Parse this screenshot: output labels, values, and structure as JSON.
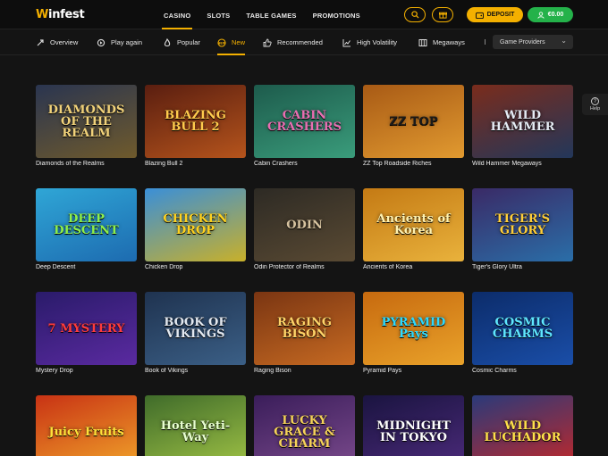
{
  "logo": {
    "text": "infest",
    "accent": "W"
  },
  "nav": {
    "items": [
      "CASINO",
      "SLOTS",
      "TABLE GAMES",
      "PROMOTIONS"
    ],
    "active": "CASINO"
  },
  "header": {
    "deposit_label": "DEPOSIT",
    "balance": "€0.00"
  },
  "categories": [
    "Overview",
    "Play again",
    "Popular",
    "New",
    "Recommended",
    "High Volatility",
    "Megaways"
  ],
  "providers": {
    "label": "Game Providers"
  },
  "help": {
    "label": "Help"
  },
  "games": [
    {
      "title": "Diamonds of the Realms",
      "art": "DIAMONDS OF THE REALM",
      "c1": "#2a3550",
      "c2": "#6f5a2c",
      "fg": "#f1d27a"
    },
    {
      "title": "Blazing Bull 2",
      "art": "BLAZING BULL 2",
      "c1": "#5a1e10",
      "c2": "#b5541c",
      "fg": "#ffcb4d"
    },
    {
      "title": "Cabin Crashers",
      "art": "CABIN CRASHERS",
      "c1": "#1d5b4c",
      "c2": "#3a9c7b",
      "fg": "#e86fb2"
    },
    {
      "title": "ZZ Top Roadside Riches",
      "art": "ZZ TOP",
      "c1": "#a85a15",
      "c2": "#e19a30",
      "fg": "#1b1b1b"
    },
    {
      "title": "Wild Hammer Megaways",
      "art": "WILD HAMMER",
      "c1": "#7a2c1c",
      "c2": "#23375a",
      "fg": "#e6ecf5"
    },
    {
      "title": "Deep Descent",
      "art": "DEEP DESCENT",
      "c1": "#2fa6d6",
      "c2": "#1d6bb0",
      "fg": "#8ff04a"
    },
    {
      "title": "Chicken Drop",
      "art": "CHICKEN DROP",
      "c1": "#3a8fd8",
      "c2": "#c8b02a",
      "fg": "#ffd21f"
    },
    {
      "title": "Odin Protector of Realms",
      "art": "ODIN",
      "c1": "#2d2a24",
      "c2": "#5a4a33",
      "fg": "#d7c3a0"
    },
    {
      "title": "Ancients of Korea",
      "art": "Ancients of Korea",
      "c1": "#c47a14",
      "c2": "#e9b23c",
      "fg": "#fff2b0"
    },
    {
      "title": "Tiger's Glory Ultra",
      "art": "TIGER'S GLORY",
      "c1": "#3a2a66",
      "c2": "#2a6ea8",
      "fg": "#ffcf3a"
    },
    {
      "title": "Mystery Drop",
      "art": "7 MYSTERY",
      "c1": "#2a1b6a",
      "c2": "#5a2aa0",
      "fg": "#ff3b3b"
    },
    {
      "title": "Book of Vikings",
      "art": "BOOK OF VIKINGS",
      "c1": "#1f3350",
      "c2": "#3b5f86",
      "fg": "#e2e8f0"
    },
    {
      "title": "Raging Bison",
      "art": "RAGING BISON",
      "c1": "#7a3512",
      "c2": "#c66a22",
      "fg": "#ffd468"
    },
    {
      "title": "Pyramid Pays",
      "art": "PYRAMID Pays",
      "c1": "#c76a0f",
      "c2": "#e9a22a",
      "fg": "#2bd9ff"
    },
    {
      "title": "Cosmic Charms",
      "art": "COSMIC CHARMS",
      "c1": "#0c2c6a",
      "c2": "#1a4ea8",
      "fg": "#5fe7ff"
    },
    {
      "title": "Juicy Fruits",
      "art": "Juicy Fruits",
      "c1": "#c83214",
      "c2": "#f0a22a",
      "fg": "#ffe23a"
    },
    {
      "title": "Hotel Yeti-Way",
      "art": "Hotel Yeti-Way",
      "c1": "#3f6b2a",
      "c2": "#9fc245",
      "fg": "#e8ffd0"
    },
    {
      "title": "Lucky Grace and Charm",
      "art": "LUCKY GRACE & CHARM",
      "c1": "#3a1d5a",
      "c2": "#7a4a8c",
      "fg": "#f6d35a"
    },
    {
      "title": "Midnight in Tokyo",
      "art": "MIDNIGHT IN TOKYO",
      "c1": "#1a1440",
      "c2": "#4b2a7a",
      "fg": "#ffffff"
    },
    {
      "title": "Wild Luchador",
      "art": "WILD LUCHADOR",
      "c1": "#2a3a7a",
      "c2": "#c0282a",
      "fg": "#ffe14a"
    }
  ],
  "colors": {
    "accent": "#f4b000",
    "balance_green": "#24b24a",
    "background": "#141414"
  }
}
